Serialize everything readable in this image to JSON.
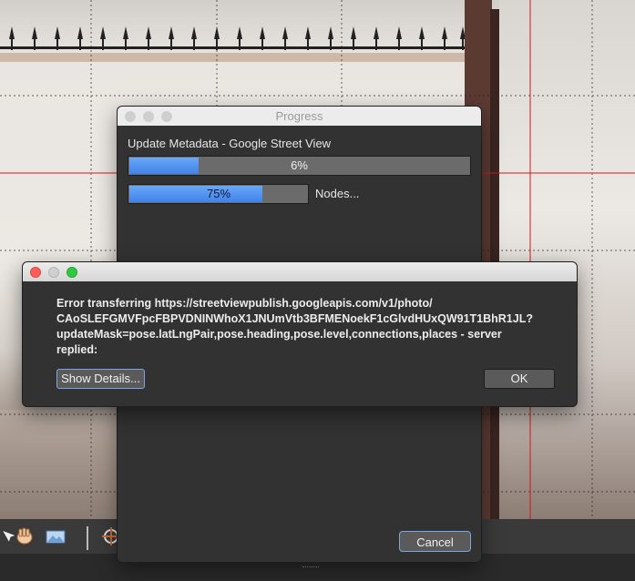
{
  "progress_dialog": {
    "title": "Progress",
    "task_label": "Update Metadata - Google Street View",
    "main_progress": {
      "value_percent": 6,
      "text": "6%"
    },
    "sub_progress": {
      "value_percent": 75,
      "text": "75%"
    },
    "sub_label": "Nodes...",
    "cancel_label": "Cancel"
  },
  "error_dialog": {
    "message_line1": "Error transferring https://streetviewpublish.googleapis.com/v1/photo/",
    "message_line2": "CAoSLEFGMVFpcFBPVDNINWhoX1JNUmVtb3BFMENoekF1cGlvdHUxQW91T1BhR1JL?",
    "message_line3": "updateMask=pose.latLngPair,pose.heading,pose.level,connections,places - server",
    "message_line4": "replied:",
    "details_label": "Show Details...",
    "ok_label": "OK"
  },
  "toolbar": {
    "icons": [
      "pointer-icon",
      "hand-icon",
      "image-layer-icon",
      "crosshair-icon"
    ]
  },
  "colors": {
    "accent_blue": "#3f82ea",
    "dialog_bg": "#323232",
    "grid_red": "#d01818"
  }
}
